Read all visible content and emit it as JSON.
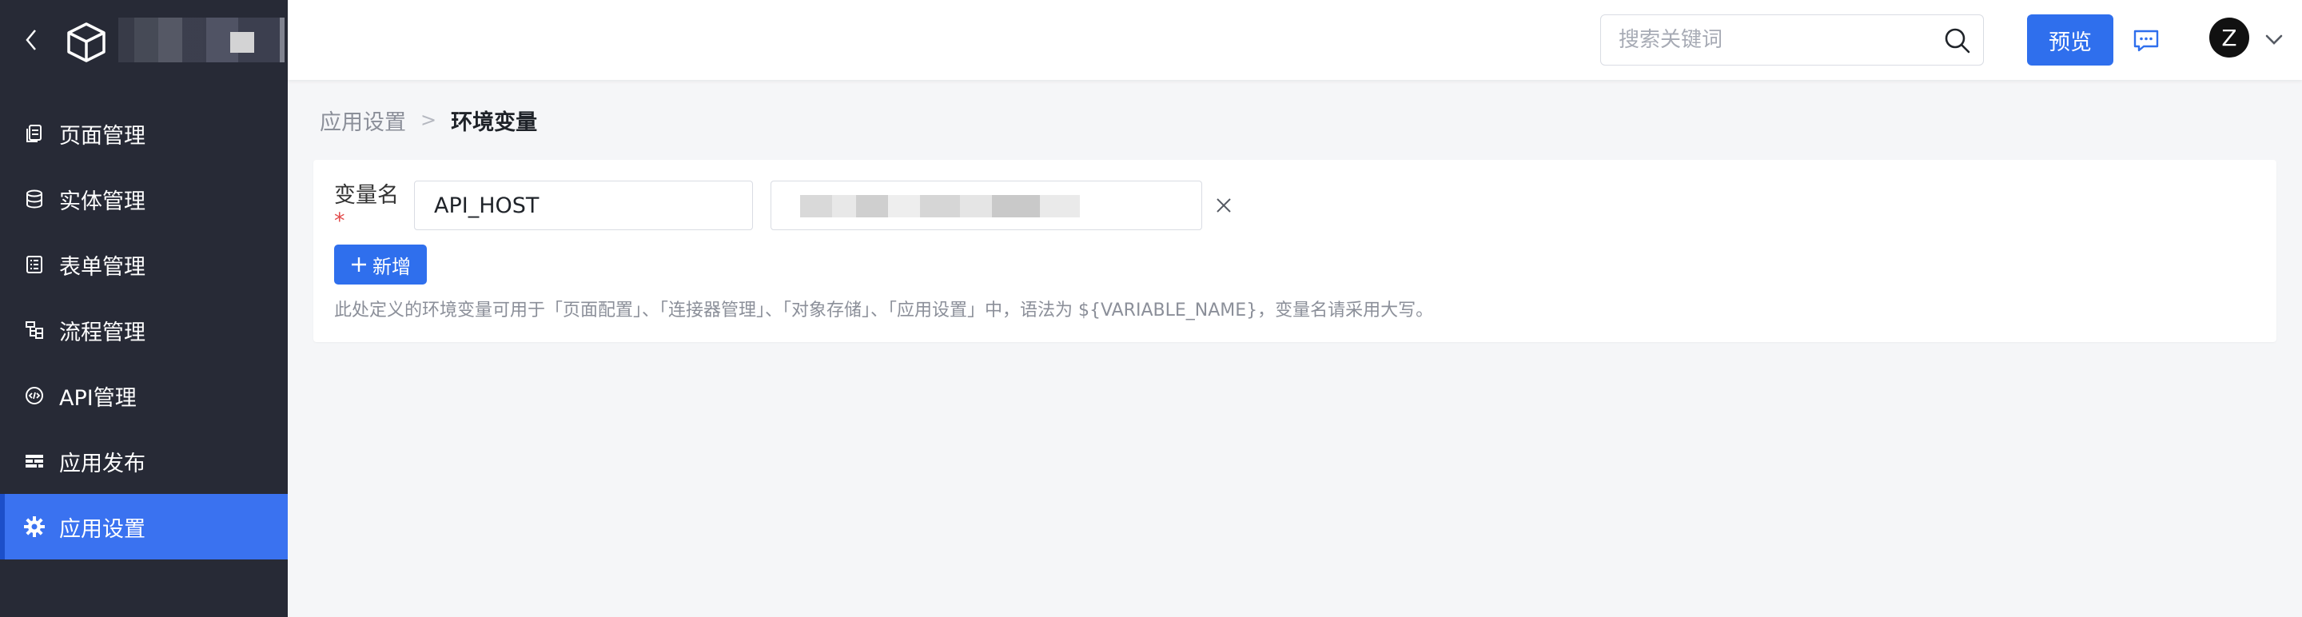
{
  "sidebar": {
    "items": [
      {
        "label": "页面管理",
        "icon": "page-icon",
        "active": false
      },
      {
        "label": "实体管理",
        "icon": "database-icon",
        "active": false
      },
      {
        "label": "表单管理",
        "icon": "form-icon",
        "active": false
      },
      {
        "label": "流程管理",
        "icon": "flow-icon",
        "active": false
      },
      {
        "label": "API管理",
        "icon": "api-icon",
        "active": false
      },
      {
        "label": "应用发布",
        "icon": "publish-icon",
        "active": false
      },
      {
        "label": "应用设置",
        "icon": "gear-icon",
        "active": true
      }
    ]
  },
  "header": {
    "search_placeholder": "搜索关键词",
    "preview_label": "预览",
    "avatar_letter": "Z"
  },
  "breadcrumb": {
    "parent": "应用设置",
    "separator": ">",
    "current": "环境变量"
  },
  "env": {
    "field_label": "变量名",
    "required_mark": "*",
    "variables": [
      {
        "name": "API_HOST",
        "value": ""
      }
    ],
    "add_label": "新增",
    "hint": "此处定义的环境变量可用于「页面配置」、「连接器管理」、「对象存储」、「应用设置」中，语法为 ${VARIABLE_NAME}，变量名请采用大写。"
  },
  "colors": {
    "sidebar_bg": "#272a36",
    "accent": "#2f6fed",
    "active_item": "#3a72f0",
    "page_bg": "#f5f6f8"
  }
}
